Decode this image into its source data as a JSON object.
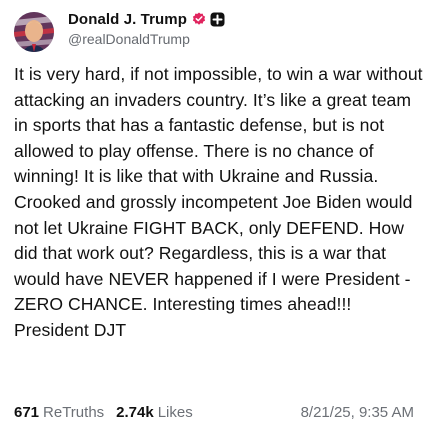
{
  "author": {
    "display_name": "Donald J. Trump",
    "handle": "@realDonaldTrump",
    "verified_badge_icon": "verified-badge-icon",
    "platform_badge_icon": "truth-social-badge-icon",
    "verified_color": "#e0245e"
  },
  "post": {
    "text": "It is very hard, if not impossible, to win a war without attacking an invaders country. It’s like a great team in sports that has a fantastic defense, but is not allowed to play offense. There is no chance of winning! It is like that with Ukraine and Russia. Crooked and grossly incompetent Joe Biden would not let Ukraine FIGHT BACK, only DEFEND. How did that work out? Regardless, this is a war that would have NEVER happened if I were President - ZERO CHANCE. Interesting times ahead!!! President DJT"
  },
  "stats": {
    "retruths_count": "671",
    "retruths_label": "ReTruths",
    "likes_count": "2.74k",
    "likes_label": "Likes",
    "timestamp": "8/21/25, 9:35 AM"
  }
}
